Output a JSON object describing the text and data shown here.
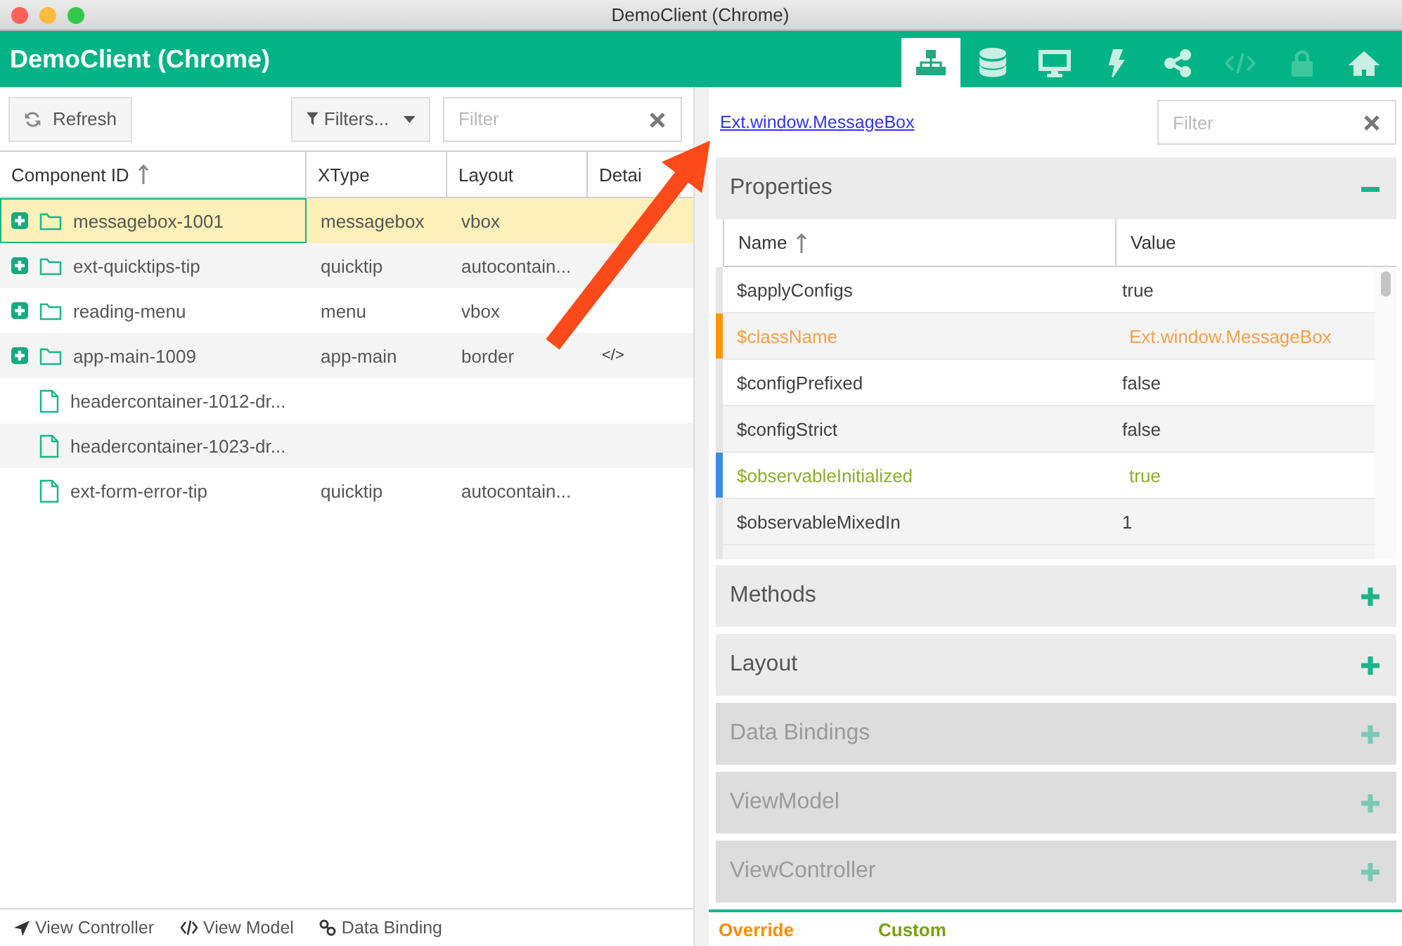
{
  "window": {
    "title": "DemoClient (Chrome)"
  },
  "app_header": {
    "title": "DemoClient (Chrome)"
  },
  "nav_tabs": [
    {
      "kind": "tree",
      "selected": true,
      "disabled": false
    },
    {
      "kind": "database",
      "selected": false,
      "disabled": false
    },
    {
      "kind": "monitor",
      "selected": false,
      "disabled": false
    },
    {
      "kind": "bolt",
      "selected": false,
      "disabled": false
    },
    {
      "kind": "share",
      "selected": false,
      "disabled": false
    },
    {
      "kind": "code",
      "selected": false,
      "disabled": true
    },
    {
      "kind": "lock",
      "selected": false,
      "disabled": true
    },
    {
      "kind": "home",
      "selected": false,
      "disabled": false
    }
  ],
  "left_toolbar": {
    "refresh_button": "Refresh",
    "filters_button": "Filters...",
    "filter_field": {
      "placeholder": "Filter"
    }
  },
  "component_grid": {
    "columns": [
      {
        "label": "Component ID",
        "sorted": true
      },
      {
        "label": "XType",
        "sorted": false
      },
      {
        "label": "Layout",
        "sorted": false
      },
      {
        "label": "Detai",
        "sorted": false
      }
    ],
    "rows": [
      {
        "kind": "folder",
        "id": "messagebox-1001",
        "xtype": "messagebox",
        "layout": "vbox",
        "details": "",
        "selected": true
      },
      {
        "kind": "folder",
        "id": "ext-quicktips-tip",
        "xtype": "quicktip",
        "layout": "autocontain...",
        "details": "",
        "selected": false
      },
      {
        "kind": "folder",
        "id": "reading-menu",
        "xtype": "menu",
        "layout": "vbox",
        "details": "",
        "selected": false
      },
      {
        "kind": "folder",
        "id": "app-main-1009",
        "xtype": "app-main",
        "layout": "border",
        "details": "</>",
        "selected": false
      },
      {
        "kind": "file",
        "id": "headercontainer-1012-dr...",
        "xtype": "",
        "layout": "",
        "details": "",
        "selected": false
      },
      {
        "kind": "file",
        "id": "headercontainer-1023-dr...",
        "xtype": "",
        "layout": "",
        "details": "",
        "selected": false
      },
      {
        "kind": "file",
        "id": "ext-form-error-tip",
        "xtype": "quicktip",
        "layout": "autocontain...",
        "details": "",
        "selected": false
      }
    ]
  },
  "footer_links": [
    {
      "kind": "navigate",
      "label": "View Controller"
    },
    {
      "kind": "code",
      "label": "View Model"
    },
    {
      "kind": "link",
      "label": "Data Binding"
    }
  ],
  "detail_panel": {
    "class_link": "Ext.window.MessageBox",
    "filter_field": {
      "placeholder": "Filter"
    },
    "sections": [
      {
        "title": "Properties",
        "expanded": true,
        "disabled": false
      },
      {
        "title": "Methods",
        "expanded": false,
        "disabled": false
      },
      {
        "title": "Layout",
        "expanded": false,
        "disabled": false
      },
      {
        "title": "Data Bindings",
        "expanded": false,
        "disabled": true
      },
      {
        "title": "ViewModel",
        "expanded": false,
        "disabled": true
      },
      {
        "title": "ViewController",
        "expanded": false,
        "disabled": true
      }
    ],
    "property_grid": {
      "columns": [
        {
          "label": "Name",
          "sorted": true
        },
        {
          "label": "Value",
          "sorted": false
        }
      ],
      "rows": [
        {
          "kind": "normal",
          "name": "$applyConfigs",
          "value": "true"
        },
        {
          "kind": "override",
          "name": "$className",
          "value": "Ext.window.MessageBox"
        },
        {
          "kind": "normal",
          "name": "$configPrefixed",
          "value": "false"
        },
        {
          "kind": "normal",
          "name": "$configStrict",
          "value": "false"
        },
        {
          "kind": "custom",
          "name": "$observableInitialized",
          "value": "true"
        },
        {
          "kind": "normal",
          "name": "$observableMixedIn",
          "value": "1"
        }
      ]
    },
    "legend": [
      {
        "kind": "override",
        "label": "Override"
      },
      {
        "kind": "custom",
        "label": "Custom"
      }
    ]
  }
}
